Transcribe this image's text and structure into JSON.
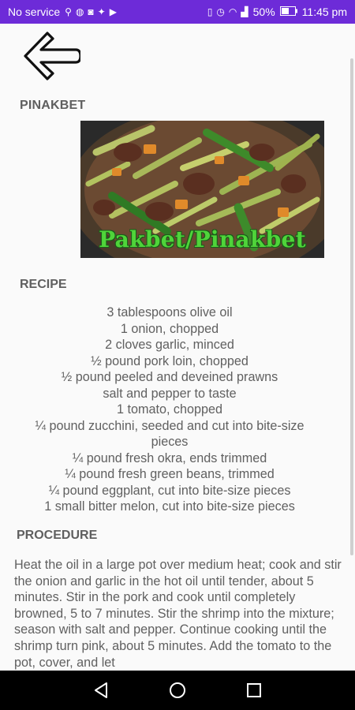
{
  "status_bar": {
    "carrier": "No service",
    "battery": "50%",
    "time": "11:45 pm",
    "left_icons": [
      "usb-icon",
      "messenger-icon",
      "instagram-icon",
      "twitter-icon",
      "youtube-icon"
    ],
    "right_icons": [
      "vibrate-icon",
      "alarm-icon",
      "wifi-icon",
      "signal-icon",
      "battery-icon"
    ]
  },
  "app": {
    "back_icon": "arrow-left-icon",
    "title": "PINAKBET",
    "image_caption": "Pakbet/Pinakbet",
    "recipe_heading": "RECIPE",
    "ingredients": [
      "3 tablespoons olive oil",
      "1 onion, chopped",
      "2 cloves garlic, minced",
      "½ pound pork loin, chopped",
      "½ pound peeled and deveined prawns",
      "salt and pepper to taste",
      "1 tomato, chopped",
      "¼ pound zucchini, seeded and cut into bite-size pieces",
      "¼ pound fresh okra, ends trimmed",
      "¼ pound fresh green beans, trimmed",
      "¼ pound eggplant, cut into bite-size pieces",
      "1 small bitter melon, cut into bite-size pieces"
    ],
    "procedure_heading": "PROCEDURE",
    "procedure": "Heat the oil in a large pot over medium heat; cook and stir the onion and garlic in the hot oil until tender, about 5 minutes. Stir in the pork and cook until completely browned, 5 to 7 minutes. Stir the shrimp into the mixture; season with salt and pepper. Continue cooking until the shrimp turn pink, about 5 minutes. Add the tomato to the pot, cover, and let"
  },
  "nav_bar": {
    "back": "triangle-back-icon",
    "home": "circle-home-icon",
    "recents": "square-recents-icon"
  },
  "colors": {
    "status_bar": "#6d2bd8",
    "background": "#fafafa",
    "text": "#606060",
    "caption": "#4fd43a"
  }
}
